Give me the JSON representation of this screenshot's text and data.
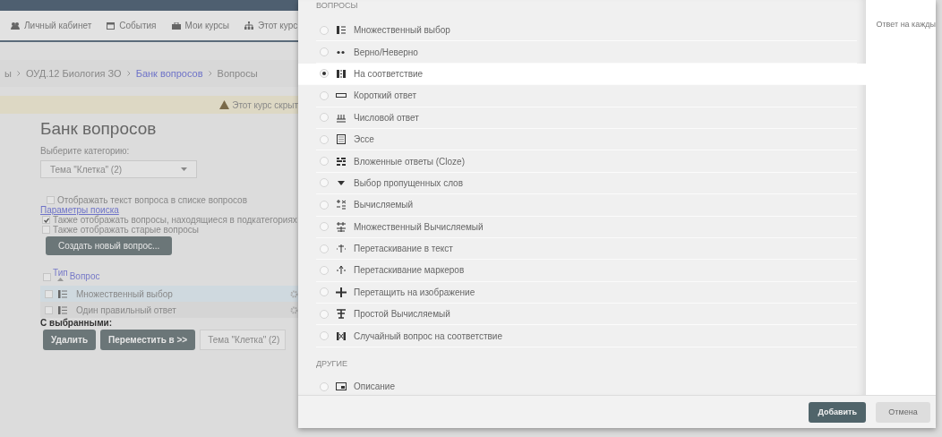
{
  "nav": [
    {
      "label": "Личный кабинет",
      "kind": "user"
    },
    {
      "label": "События",
      "kind": "calendar"
    },
    {
      "label": "Мои курсы",
      "kind": "briefcase"
    },
    {
      "label": "Этот курс",
      "kind": "sitemap"
    }
  ],
  "breadcrumb": [
    {
      "label": "ы",
      "link": false
    },
    {
      "label": "ОУД.12 Биология ЗО",
      "link": false
    },
    {
      "label": "Банк вопросов",
      "link": true
    },
    {
      "label": "Вопросы",
      "link": false
    }
  ],
  "notice": "Этот курс скрыт",
  "heading": "Банк вопросов",
  "category_label": "Выберите категорию:",
  "category_select": "Тема \"Клетка\" (2)",
  "show_text_option": {
    "label": "Отображать текст вопроса в списке вопросов",
    "checked": false
  },
  "search_params_link": "Параметры поиска",
  "search_options": [
    {
      "label": "Также отображать вопросы, находящиеся в подкатегориях",
      "checked": true
    },
    {
      "label": "Также отображать старые вопросы",
      "checked": false
    }
  ],
  "create_button": "Создать новый вопрос...",
  "table": {
    "select_all": {
      "checked": false
    },
    "columns": [
      "Тип",
      "Вопрос"
    ],
    "rows": [
      {
        "name": "Множественный выбор",
        "selected": true
      },
      {
        "name": "Один правильный ответ",
        "selected": false
      }
    ]
  },
  "bulk_label": "С выбранными:",
  "bulk_buttons": [
    "Удалить",
    "Переместить в >>"
  ],
  "bulk_target": "Тема \"Клетка\" (2)",
  "dialog": {
    "sections": [
      {
        "title": "ВОПРОСЫ",
        "items": [
          {
            "label": "Множественный выбор",
            "kind": "multichoice",
            "selected": false
          },
          {
            "label": "Верно/Неверно",
            "kind": "truefalse",
            "selected": false
          },
          {
            "label": "На соответствие",
            "kind": "match",
            "selected": true
          },
          {
            "label": "Короткий ответ",
            "kind": "shortanswer",
            "selected": false
          },
          {
            "label": "Числовой ответ",
            "kind": "numerical",
            "selected": false
          },
          {
            "label": "Эссе",
            "kind": "essay",
            "selected": false
          },
          {
            "label": "Вложенные ответы (Cloze)",
            "kind": "cloze",
            "selected": false
          },
          {
            "label": "Выбор пропущенных слов",
            "kind": "gapselect",
            "selected": false
          },
          {
            "label": "Вычисляемый",
            "kind": "calculated",
            "selected": false
          },
          {
            "label": "Множественный Вычисляемый",
            "kind": "calcmulti",
            "selected": false
          },
          {
            "label": "Перетаскивание в текст",
            "kind": "ddtext",
            "selected": false
          },
          {
            "label": "Перетаскивание маркеров",
            "kind": "ddmarker",
            "selected": false
          },
          {
            "label": "Перетащить на изображение",
            "kind": "ddimage",
            "selected": false
          },
          {
            "label": "Простой Вычисляемый",
            "kind": "calcsimple",
            "selected": false
          },
          {
            "label": "Случайный вопрос на соответствие",
            "kind": "randommatch",
            "selected": false
          }
        ]
      },
      {
        "title": "ДРУГИЕ",
        "items": [
          {
            "label": "Описание",
            "kind": "description",
            "selected": false
          }
        ]
      }
    ],
    "summary": "Ответ на кажды",
    "buttons": [
      {
        "label": "Добавить",
        "kind": "primary"
      },
      {
        "label": "Отмена",
        "kind": "secondary"
      }
    ]
  }
}
